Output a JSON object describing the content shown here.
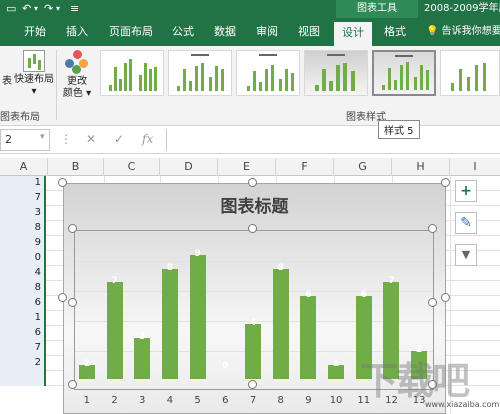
{
  "titlebar": {
    "chart_tools": "图表工具",
    "doc_title": "2008-2009学年度学"
  },
  "tabs": [
    {
      "label": "开始"
    },
    {
      "label": "插入"
    },
    {
      "label": "页面布局"
    },
    {
      "label": "公式"
    },
    {
      "label": "数据"
    },
    {
      "label": "审阅"
    },
    {
      "label": "视图"
    },
    {
      "label": "设计"
    },
    {
      "label": "格式"
    }
  ],
  "active_tab": "设计",
  "tell_me": "告诉我你想要做",
  "ribbon": {
    "chart_label": "表",
    "quick_layout": "快速布局",
    "quick_layout_arrow": "▾",
    "change_colors_1": "更改",
    "change_colors_2": "颜色",
    "change_colors_arrow": "▾",
    "layouts_group": "图表布局",
    "styles_group": "图表样式",
    "tooltip": "样式 5"
  },
  "formula_bar": {
    "name_box": "2",
    "fx": "fx",
    "cancel": "✕",
    "confirm": "✓"
  },
  "columns": [
    "A",
    "B",
    "C",
    "D",
    "E",
    "F",
    "G",
    "H",
    "I"
  ],
  "column_a_values": [
    "1",
    "7",
    "3",
    "8",
    "9",
    "0",
    "4",
    "8",
    "6",
    "1",
    "6",
    "7",
    "2",
    ""
  ],
  "chart_data": {
    "type": "bar",
    "title": "图表标题",
    "categories": [
      "1",
      "2",
      "3",
      "4",
      "5",
      "6",
      "7",
      "8",
      "9",
      "10",
      "11",
      "12",
      "13"
    ],
    "values": [
      1,
      7,
      3,
      8,
      9,
      0,
      4,
      8,
      6,
      1,
      6,
      7,
      2
    ],
    "ylim": [
      0,
      10
    ],
    "color": "#70AD47",
    "grid": true,
    "legend": "none"
  },
  "side_buttons": {
    "add": "+",
    "style": "✎",
    "filter": "▼"
  },
  "watermark": {
    "text": "下载吧",
    "url": "www.xiazaiba.com"
  },
  "colors": {
    "brand": "#217346",
    "bar": "#70AD47"
  }
}
